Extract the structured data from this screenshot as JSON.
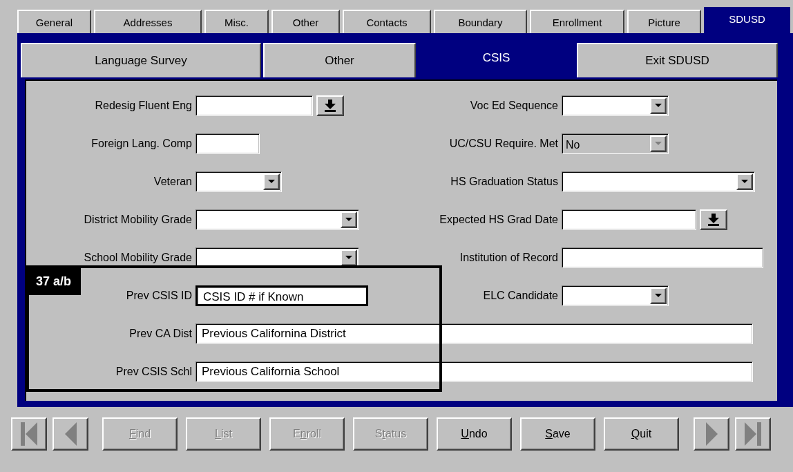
{
  "tabs": [
    {
      "label": "General",
      "selected": false
    },
    {
      "label": "Addresses",
      "selected": false
    },
    {
      "label": "Misc.",
      "selected": false
    },
    {
      "label": "Other",
      "selected": false
    },
    {
      "label": "Contacts",
      "selected": false
    },
    {
      "label": "Boundary",
      "selected": false
    },
    {
      "label": "Enrollment",
      "selected": false
    },
    {
      "label": "Picture",
      "selected": false
    },
    {
      "label": "SDUSD",
      "selected": true
    }
  ],
  "subtabs": [
    {
      "label": "Language Survey",
      "selected": false
    },
    {
      "label": "Other",
      "selected": false
    },
    {
      "label": "CSIS",
      "selected": true
    },
    {
      "label": "Exit SDUSD",
      "selected": false
    }
  ],
  "form": {
    "left": [
      {
        "label": "Redesig Fluent Eng",
        "kind": "date",
        "disabled": false,
        "focused": false
      },
      {
        "label": "Foreign Lang. Comp",
        "kind": "text",
        "disabled": false,
        "focused": false
      },
      {
        "label": "Veteran",
        "kind": "dropdown",
        "disabled": false,
        "focused": false
      },
      {
        "label": "District Mobility Grade",
        "kind": "dropdown",
        "disabled": false,
        "focused": false
      },
      {
        "label": "School Mobility Grade",
        "kind": "dropdown",
        "disabled": false,
        "focused": false
      },
      {
        "label": "Prev CSIS ID",
        "kind": "text",
        "value": "CSIS ID # if Known",
        "disabled": false,
        "focused": true
      }
    ],
    "right": [
      {
        "label": "Voc Ed Sequence",
        "kind": "dropdown",
        "disabled": false,
        "focused": false
      },
      {
        "label": "UC/CSU Require. Met",
        "kind": "dropdown",
        "value": "No",
        "disabled": true,
        "focused": false
      },
      {
        "label": "HS Graduation Status",
        "kind": "dropdown",
        "disabled": false,
        "focused": false
      },
      {
        "label": "Expected HS Grad Date",
        "kind": "date",
        "disabled": false,
        "focused": false
      },
      {
        "label": "Institution of Record",
        "kind": "text",
        "disabled": false,
        "focused": false
      },
      {
        "label": "ELC Candidate",
        "kind": "dropdown",
        "disabled": false,
        "focused": false
      }
    ],
    "wide": [
      {
        "label": "Prev CA Dist",
        "kind": "text",
        "value": "Previous Californina District",
        "disabled": false,
        "focused": false
      },
      {
        "label": "Prev CSIS Schl",
        "kind": "text",
        "value": "Previous California School",
        "disabled": false,
        "focused": false
      }
    ]
  },
  "annotation": {
    "label": "37 a/b"
  },
  "buttons": [
    {
      "key": "F",
      "after": "ind",
      "disabled": true
    },
    {
      "key": "L",
      "after": "ist",
      "disabled": true
    },
    {
      "before": "E",
      "key": "n",
      "after": "roll",
      "disabled": true
    },
    {
      "before": "S",
      "key": "t",
      "after": "atus",
      "disabled": true
    },
    {
      "key": "U",
      "after": "ndo",
      "disabled": false
    },
    {
      "key": "S",
      "after": "ave",
      "disabled": false
    },
    {
      "key": "Q",
      "after": "uit",
      "disabled": false
    }
  ]
}
